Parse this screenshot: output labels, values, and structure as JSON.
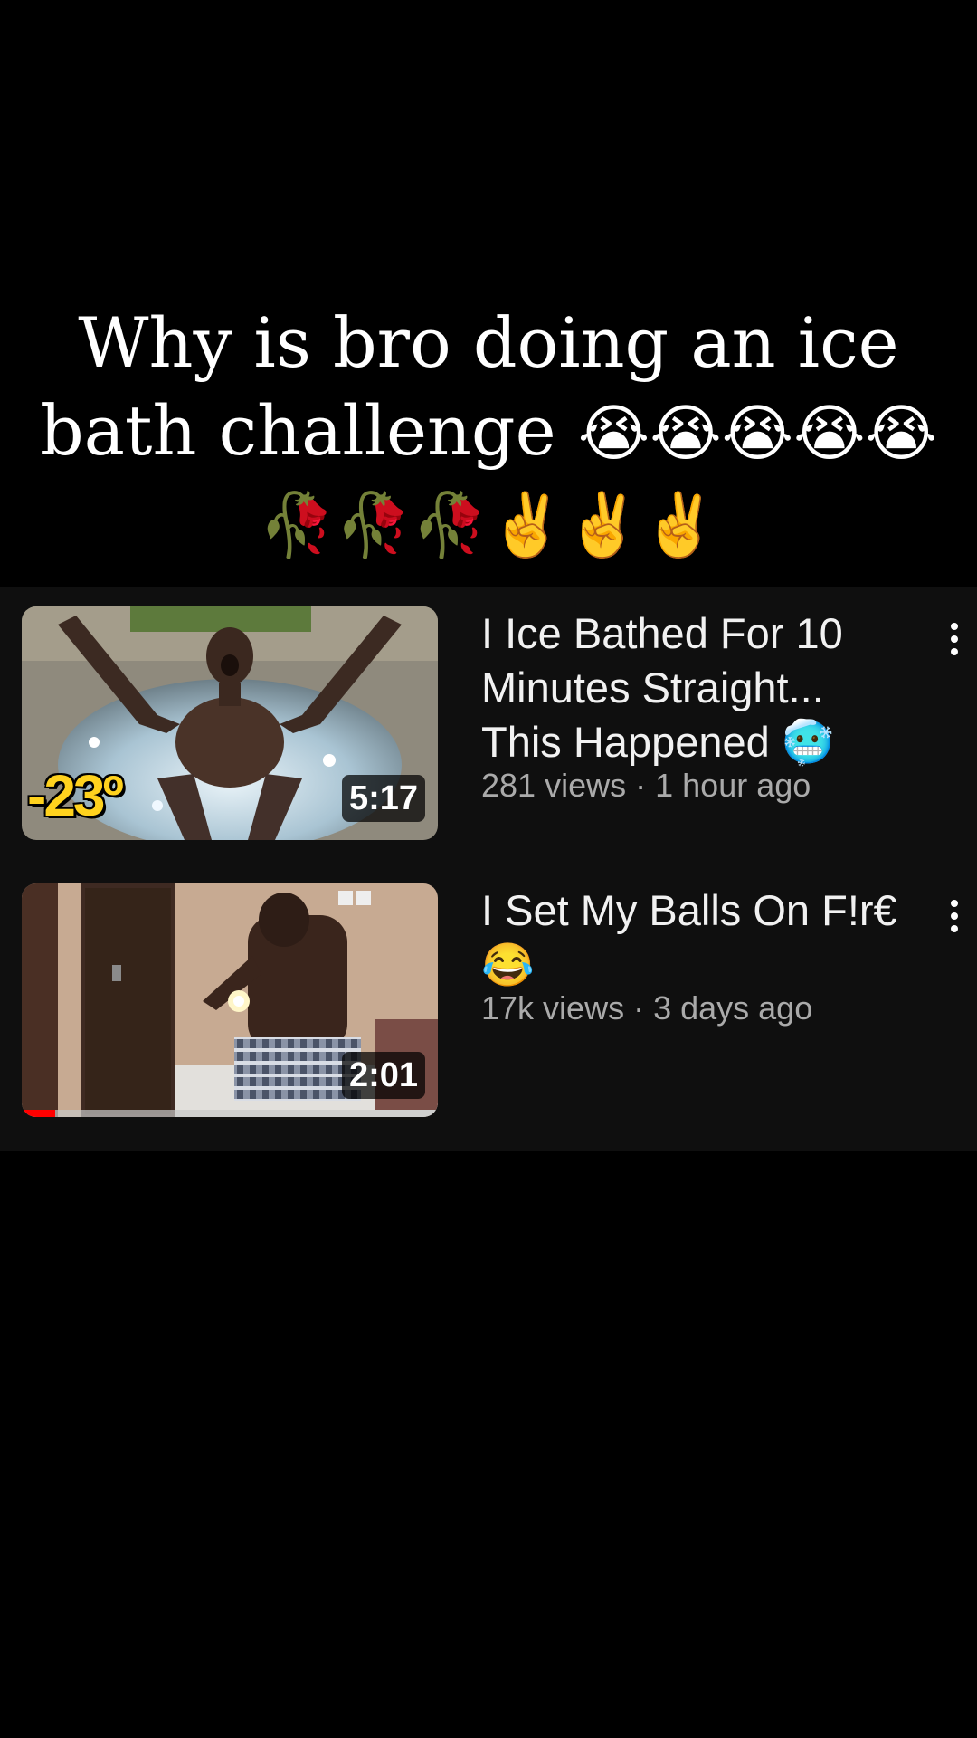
{
  "caption": {
    "text": "Why is bro doing an ice bath challenge",
    "emojis": "😭😭😭😭😭🥀🥀🥀✌️✌️✌️"
  },
  "videos": [
    {
      "title": "I Ice Bathed For 10 Minutes Straight... This Happened 🥶",
      "views": "281 views",
      "age": "1 hour ago",
      "separator": "·",
      "duration": "5:17",
      "thumbnail_badge": "-23º",
      "thumbnail_icon": "ice-bath-person-image"
    },
    {
      "title": "I Set My Balls On F!r€ 😂",
      "views": "17k views",
      "age": "3 days ago",
      "separator": "·",
      "duration": "2:01",
      "watched_progress": 0.08,
      "thumbnail_icon": "person-with-fire-image"
    }
  ],
  "colors": {
    "background": "#000000",
    "list_background": "#0f0f0f",
    "progress": "#ff0000",
    "badge_yellow": "#ffd21e"
  }
}
